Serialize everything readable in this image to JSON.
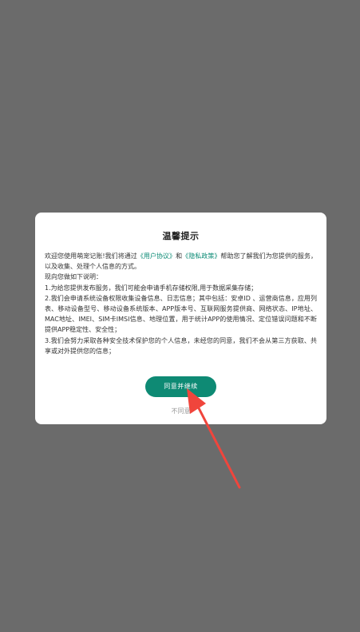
{
  "dialog": {
    "title": "温馨提示",
    "intro_before": "欢迎您使用萌宠记账!我们将通过",
    "link_user_agreement": "《用户协议》",
    "intro_and": "和",
    "link_privacy_policy": "《隐私政策》",
    "intro_after": "帮助您了解我们为您提供的服务，以及收集、处理个人信息的方式。",
    "explain_heading": "现向您做如下说明：",
    "item1": "1.为给您提供发布服务，我们可能会申请手机存储权限,用于数据采集存储；",
    "item2": "2.我们会申请系统设备权限收集设备信息、日志信息；其中包括：安卓ID 、运营商信息，应用列表、移动设备型号、移动设备系统版本、APP版本号、互联网服务提供商、网络状态、IP地址、MAC地址、IMEI、SIM卡IMSI信息、地理位置，用于统计APP的使用情况、定位错误问题和不断提供APP稳定性、安全性；",
    "item3": "3.我们会努力采取各种安全技术保护您的个人信息，未经您的同意，我们不会从第三方获取、共享或对外提供您的信息；",
    "agree_label": "同意并继续",
    "disagree_label": "不同意"
  },
  "colors": {
    "overlay": "#6b6b6b",
    "accent": "#0e8a74",
    "arrow": "#f0453c"
  }
}
